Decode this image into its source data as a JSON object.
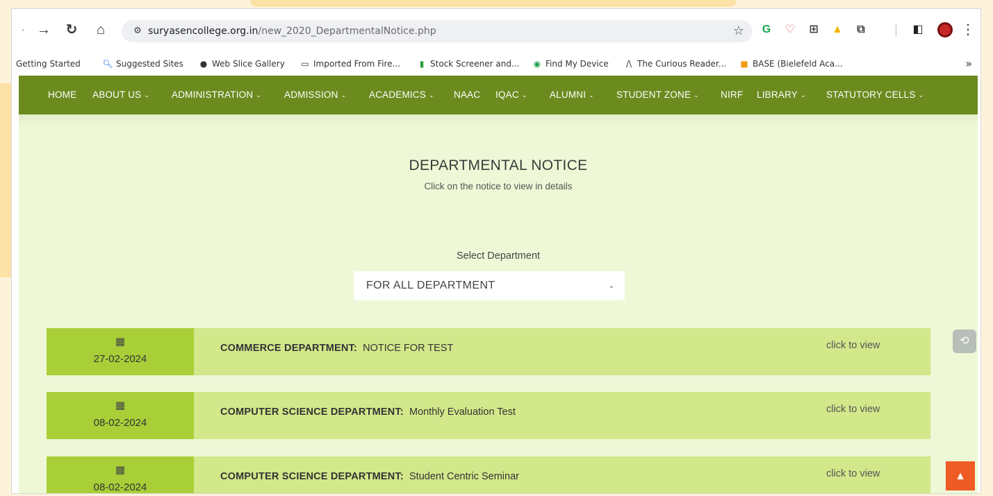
{
  "browser": {
    "url_host": "suryasencollege.org.in",
    "url_path": "/new_2020_DepartmentalNotice.php",
    "bookmarks": [
      {
        "label": "Getting Started",
        "icon": "bookmark-icon"
      },
      {
        "label": "Suggested Sites",
        "icon": "search-icon"
      },
      {
        "label": "Web Slice Gallery",
        "icon": "globe-icon"
      },
      {
        "label": "Imported From Fire...",
        "icon": "folder-icon"
      },
      {
        "label": "Stock Screener and...",
        "icon": "bar-chart-icon"
      },
      {
        "label": "Find My Device",
        "icon": "find-device-icon"
      },
      {
        "label": "The Curious Reader...",
        "icon": "curious-reader-icon"
      },
      {
        "label": "BASE (Bielefeld Aca...",
        "icon": "base-icon"
      }
    ],
    "more_label": "»",
    "colors": {
      "omnibox_bg": "#eef0f3"
    }
  },
  "nav": {
    "items": [
      {
        "label": "HOME",
        "dropdown": false
      },
      {
        "label": "ABOUT US",
        "dropdown": true
      },
      {
        "label": "ADMINISTRATION",
        "dropdown": true
      },
      {
        "label": "ADMISSION",
        "dropdown": true
      },
      {
        "label": "ACADEMICS",
        "dropdown": true
      },
      {
        "label": "NAAC",
        "dropdown": false
      },
      {
        "label": "IQAC",
        "dropdown": true
      },
      {
        "label": "ALUMNI",
        "dropdown": true
      },
      {
        "label": "STUDENT ZONE",
        "dropdown": true
      },
      {
        "label": "NIRF",
        "dropdown": false
      },
      {
        "label": "LIBRARY",
        "dropdown": true
      },
      {
        "label": "STATUTORY CELLS",
        "dropdown": true
      }
    ],
    "caret": "⌄",
    "colors": {
      "bar": "#6b8b1f"
    }
  },
  "page": {
    "title": "DEPARTMENTAL NOTICE",
    "subtitle": "Click on the notice to view in details",
    "select_label": "Select Department",
    "select_value": "FOR ALL DEPARTMENT"
  },
  "notices": [
    {
      "date": "27-02-2024",
      "department": "COMMERCE DEPARTMENT:",
      "title": "NOTICE FOR TEST",
      "cta": "click to view"
    },
    {
      "date": "08-02-2024",
      "department": "COMPUTER SCIENCE DEPARTMENT:",
      "title": "Monthly Evaluation Test",
      "cta": "click to view"
    },
    {
      "date": "08-02-2024",
      "department": "COMPUTER SCIENCE DEPARTMENT:",
      "title": "Student Centric Seminar",
      "cta": "click to view"
    }
  ],
  "colors": {
    "content_bg": "#eef8d6",
    "date_box": "#a9cf38",
    "notice_bg": "#d2e88a",
    "scroll_top": "#ef5b25"
  }
}
